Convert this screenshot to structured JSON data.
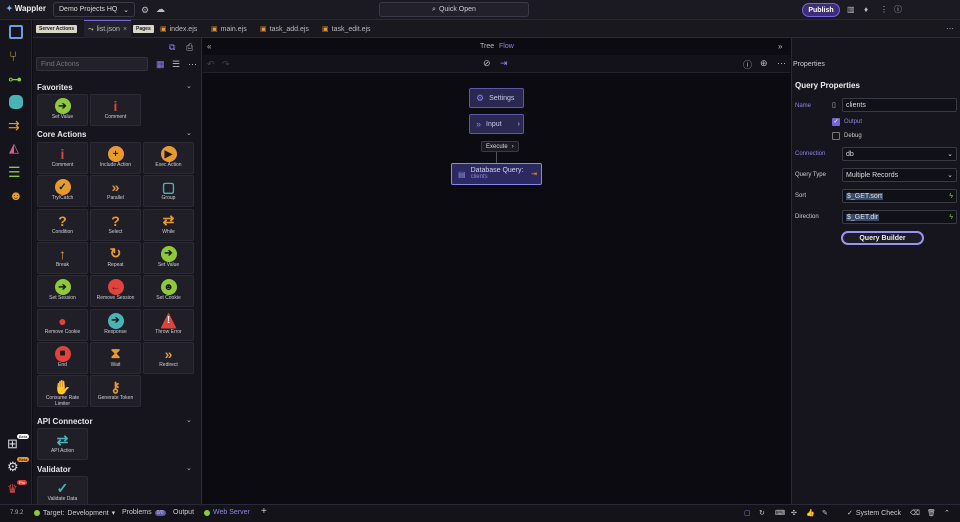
{
  "app": {
    "logo": "Wappler",
    "project": "Demo Projects HQ",
    "quick_open": "Quick Open",
    "publish": "Publish",
    "version": "7.9.2"
  },
  "tabs": {
    "server_actions_tag": "Server Actions",
    "pages_tag": "Pages",
    "items": [
      "list.json",
      "index.ejs",
      "main.ejs",
      "task_add.ejs",
      "task_edit.ejs"
    ]
  },
  "left": {
    "find_placeholder": "Find Actions",
    "sections": {
      "favorites": "Favorites",
      "core": "Core Actions",
      "api": "API Connector",
      "validator": "Validator"
    },
    "favorites": [
      "Set Value",
      "Comment"
    ],
    "core": [
      "Comment",
      "Include Action",
      "Exec Action",
      "Try/Catch",
      "Parallel",
      "Group",
      "Condition",
      "Select",
      "While",
      "Break",
      "Repeat",
      "Set Value",
      "Set Session",
      "Remove Session",
      "Set Cookie",
      "Remove Cookie",
      "Response",
      "Throw Error",
      "End",
      "Wait",
      "Redirect",
      "Consume Rate Limiter",
      "Generate Token"
    ],
    "api": [
      "API Action"
    ],
    "validator": [
      "Validate Data"
    ]
  },
  "canvas": {
    "tree": "Tree",
    "flow": "Flow",
    "nodes": {
      "settings": "Settings",
      "input": "Input",
      "execute": "Execute",
      "query_title": "Database Query:",
      "query_sub": "clients"
    }
  },
  "props": {
    "header": "Properties",
    "title": "Query Properties",
    "name_label": "Name",
    "name_value": "clients",
    "output": "Output",
    "debug": "Debug",
    "connection_label": "Connection",
    "connection_value": "db",
    "qtype_label": "Query Type",
    "qtype_value": "Multiple Records",
    "sort_label": "Sort",
    "sort_value": "$_GET.sort",
    "dir_label": "Direction",
    "dir_value": "$_GET.dir",
    "builder": "Query Builder"
  },
  "status": {
    "target_label": "Target:",
    "target_value": "Development",
    "problems": "Problems",
    "problems_count": "0/0",
    "output": "Output",
    "web_server": "Web Server",
    "system_check": "System Check"
  },
  "rail_badges": [
    "Beta",
    "Beta",
    "Pro"
  ],
  "colors": {
    "accent": "#7566d8",
    "green": "#8fc93a",
    "orange": "#e89a2c",
    "red": "#e0433a",
    "blue": "#6f9be6",
    "teal": "#4ab3b6"
  }
}
